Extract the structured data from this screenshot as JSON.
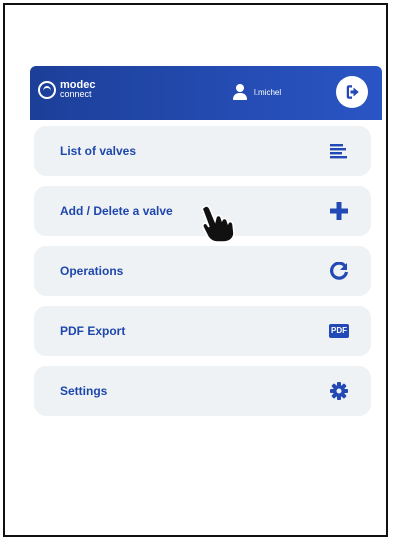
{
  "app": {
    "logo_line1": "modec",
    "logo_line2": "connect",
    "user_name": "l.michel"
  },
  "menu": {
    "items": [
      {
        "label": "List of valves",
        "icon": "list-icon"
      },
      {
        "label": "Add / Delete a valve",
        "icon": "plus-icon"
      },
      {
        "label": "Operations",
        "icon": "refresh-icon"
      },
      {
        "label": "PDF Export",
        "icon": "pdf-icon",
        "icon_text": "PDF"
      },
      {
        "label": "Settings",
        "icon": "gear-icon"
      }
    ]
  },
  "colors": {
    "header_start": "#1c3f99",
    "header_end": "#2a55c4",
    "accent": "#1e47ad",
    "item_bg": "#eef2f4"
  }
}
